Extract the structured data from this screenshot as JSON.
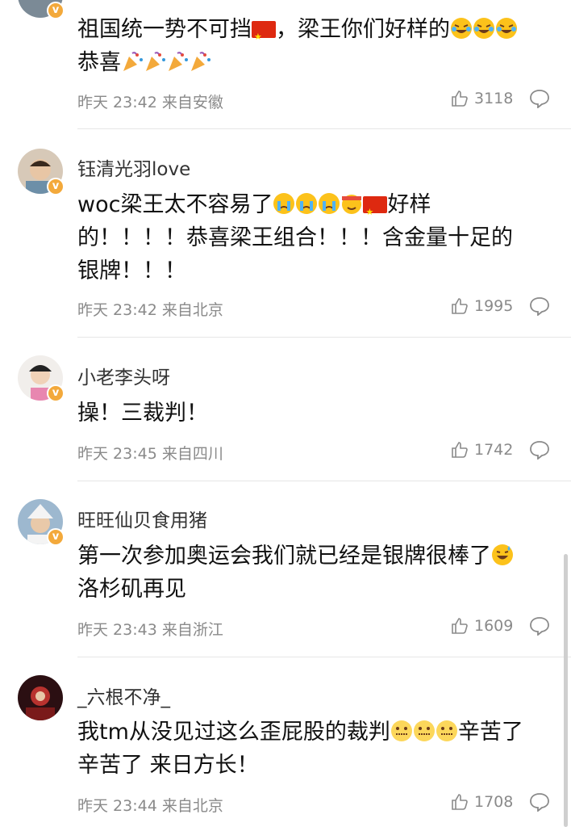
{
  "comments": [
    {
      "username": "",
      "text_a": "祖国统一势不可挡",
      "text_b": "，梁王你们好样的",
      "text_c": "恭喜",
      "time": "昨天 23:42",
      "location": "来自安徽",
      "likes": "3118"
    },
    {
      "username": "钰清光羽love",
      "text_a": "woc梁王太不容易了",
      "text_b": "好样",
      "text_c": "的！！！！恭喜梁王组合！！！含金量十足的",
      "text_d": "银牌！！！",
      "time": "昨天 23:42",
      "location": "来自北京",
      "likes": "1995"
    },
    {
      "username": "小老李头呀",
      "text_a": "操！三裁判！",
      "time": "昨天 23:45",
      "location": "来自四川",
      "likes": "1742"
    },
    {
      "username": "旺旺仙贝食用猪",
      "text_a": "第一次参加奥运会我们就已经是银牌很棒了",
      "text_b": "洛杉矶再见",
      "time": "昨天 23:43",
      "location": "来自浙江",
      "likes": "1609"
    },
    {
      "username": "_六根不净_",
      "text_a": "我tm从没见过这么歪屁股的裁判",
      "text_b": "辛苦了",
      "text_c": "辛苦了 来日方长！",
      "time": "昨天 23:44",
      "location": "来自北京",
      "likes": "1708"
    }
  ],
  "icons": {
    "like": "thumbs-up-icon",
    "reply": "comment-bubble-icon",
    "verified": "verified-badge-icon"
  },
  "colors": {
    "badge": "#f3a93b",
    "meta": "#8a8a8a"
  }
}
